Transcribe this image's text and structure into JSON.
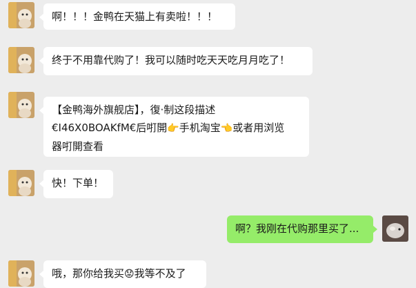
{
  "messages": [
    {
      "side": "left",
      "lines": [
        "啊！！！金鸭在天猫上有卖啦！！！"
      ]
    },
    {
      "side": "left",
      "lines": [
        "终于不用靠代购了！我可以随时吃天天吃月月吃了！"
      ]
    },
    {
      "side": "left",
      "lines": [
        "【金鸭海外旗舰店】，復·制这段描述",
        "€I46X0BOAKfM€后�britt開",
        "器咑開查看"
      ]
    },
    {
      "side": "left",
      "lines": [
        "快！下单！"
      ]
    },
    {
      "side": "right",
      "lines": [
        "啊？我刚在代购那里买了..."
      ]
    },
    {
      "side": "left",
      "lines": [
        "哦，那你给我买",
        "我等不及了"
      ]
    }
  ],
  "m3": {
    "line1": "【金鸭海外旗舰店】，復·制这段描述",
    "line2_pre": "€I46X0BOAKfM€后咑開",
    "line2_mid": "手机淘宝",
    "line2_post": "或者用浏览",
    "line3": "器咑開查看",
    "hand_right_icon": "hand-pointing-right-emoji",
    "hand_left_icon": "hand-pointing-left-emoji"
  },
  "m6": {
    "text_pre": "哦，那你给我买",
    "text_post": "我等不及了",
    "face_icon": "worried-face-emoji"
  },
  "colors": {
    "background": "#ededed",
    "bubble_left": "#ffffff",
    "bubble_right": "#95ec69",
    "text": "#1a1a1a"
  }
}
